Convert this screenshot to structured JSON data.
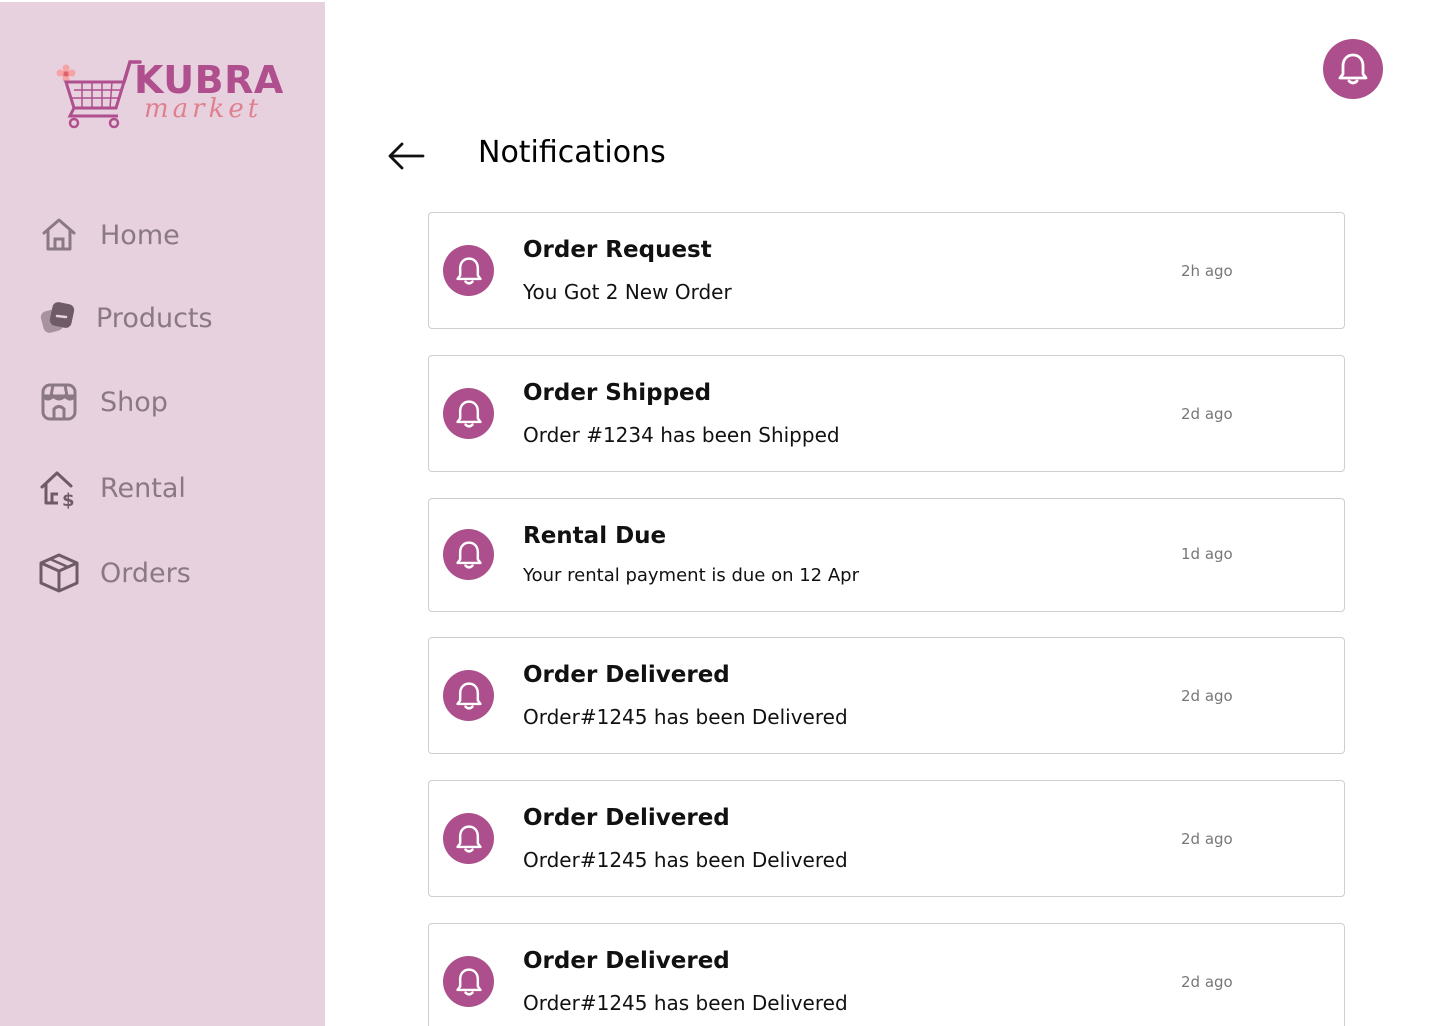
{
  "brand": {
    "name": "KUBRA",
    "subname": "market",
    "primary_color": "#ac4f8c",
    "sidebar_bg": "#e8d1df"
  },
  "sidebar": {
    "items": [
      {
        "label": "Home",
        "icon": "home-icon"
      },
      {
        "label": "Products",
        "icon": "products-icon"
      },
      {
        "label": "Shop",
        "icon": "shop-icon"
      },
      {
        "label": "Rental",
        "icon": "rental-icon"
      },
      {
        "label": "Orders",
        "icon": "orders-icon"
      }
    ]
  },
  "header": {
    "title": "Notifications",
    "back_icon": "back-arrow-icon",
    "bell_icon": "bell-icon"
  },
  "notifications": [
    {
      "title": "Order Request",
      "message": "You Got 2 New Order",
      "time": "2h ago"
    },
    {
      "title": "Order Shipped",
      "message": "Order #1234 has been Shipped",
      "time": "2d ago"
    },
    {
      "title": "Rental Due",
      "message": "Your rental payment is due on 12 Apr",
      "time": "1d ago"
    },
    {
      "title": "Order Delivered",
      "message": "Order#1245 has been Delivered",
      "time": "2d ago"
    },
    {
      "title": "Order Delivered",
      "message": "Order#1245 has been Delivered",
      "time": "2d ago"
    },
    {
      "title": "Order Delivered",
      "message": "Order#1245 has been Delivered",
      "time": "2d ago"
    }
  ]
}
